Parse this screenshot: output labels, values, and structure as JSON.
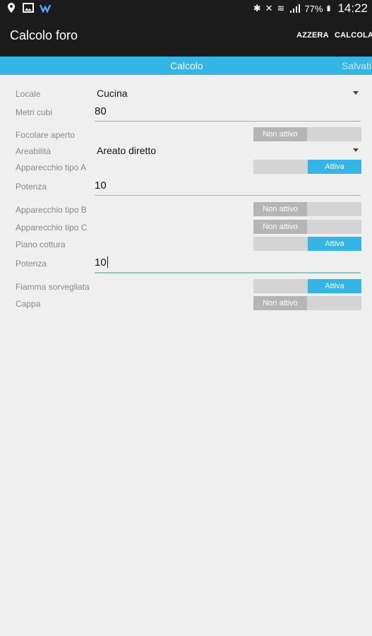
{
  "status_bar": {
    "battery": "77%",
    "time": "14:22",
    "icons": [
      "location-icon",
      "gallery-icon",
      "app-notification-icon",
      "bluetooth-icon",
      "mute-icon",
      "wifi-icon",
      "signal-icon",
      "battery-icon"
    ]
  },
  "app_bar": {
    "title": "Calcolo foro",
    "actions": {
      "azzera": "AZZERA",
      "calcola": "CALCOLA"
    }
  },
  "tabs": {
    "active": "Calcolo",
    "next": "Salvati"
  },
  "form": {
    "locale": {
      "label": "Locale",
      "value": "Cucina"
    },
    "metri_cubi": {
      "label": "Metri cubi",
      "value": "80"
    },
    "focolare_aperto": {
      "label": "Focolare aperto",
      "state": "Non attivo"
    },
    "areabilita": {
      "label": "Areabilità",
      "value": "Areato diretto"
    },
    "apparecchio_a": {
      "label": "Apparecchio tipo A",
      "state": "Attiva"
    },
    "potenza_a": {
      "label": "Potenza",
      "value": "10"
    },
    "apparecchio_b": {
      "label": "Apparecchio tipo B",
      "state": "Non attivo"
    },
    "apparecchio_c": {
      "label": "Apparecchio tipo C",
      "state": "Non attivo"
    },
    "piano_cottura": {
      "label": "Piano cottura",
      "state": "Attiva"
    },
    "potenza_piano": {
      "label": "Potenza",
      "value": "10"
    },
    "fiamma_sorvegliata": {
      "label": "Fiamma sorvegliata",
      "state": "Attiva"
    },
    "cappa": {
      "label": "Cappa",
      "state": "Non attivo"
    }
  },
  "colors": {
    "accent": "#33b5e5",
    "toggle_off": "#b5b5b5",
    "bar": "#1b1b1b",
    "background": "#efefef"
  }
}
